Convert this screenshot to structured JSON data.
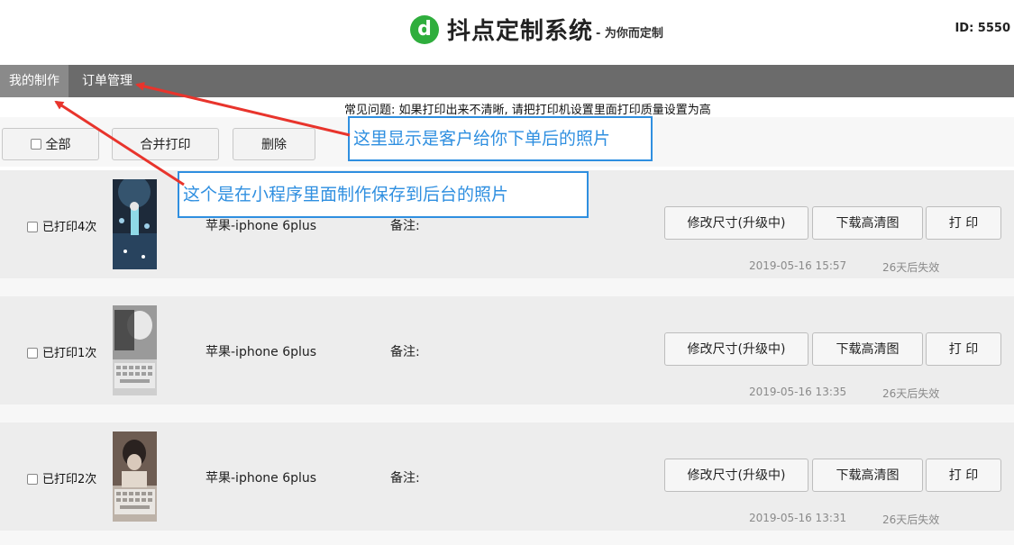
{
  "header": {
    "title": "抖点定制系统",
    "subtitle": "- 为你而定制",
    "user_id": "ID: 5550",
    "logo_letter": "d"
  },
  "nav": {
    "items": [
      "我的制作",
      "订单管理"
    ],
    "active": "我的制作"
  },
  "notice": "常见问题: 如果打印出来不清晰, 请把打印机设置里面打印质量设置为高",
  "toolbar": {
    "select_all": "全部",
    "merge_print": "合并打印",
    "delete": "删除"
  },
  "rows": [
    {
      "printed": "已打印4次",
      "model": "苹果-iphone 6plus",
      "note_label": "备注:",
      "btn_resize": "修改尺寸(升级中)",
      "btn_download": "下载高清图",
      "btn_print": "打 印",
      "time": "2019-05-16 15:57",
      "expire": "26天后失效"
    },
    {
      "printed": "已打印1次",
      "model": "苹果-iphone 6plus",
      "note_label": "备注:",
      "btn_resize": "修改尺寸(升级中)",
      "btn_download": "下载高清图",
      "btn_print": "打 印",
      "time": "2019-05-16 13:35",
      "expire": "26天后失效"
    },
    {
      "printed": "已打印2次",
      "model": "苹果-iphone 6plus",
      "note_label": "备注:",
      "btn_resize": "修改尺寸(升级中)",
      "btn_download": "下载高清图",
      "btn_print": "打 印",
      "time": "2019-05-16 13:31",
      "expire": "26天后失效"
    }
  ],
  "annotations": {
    "orders_note": "这里显示是客户给你下单后的照片",
    "works_note": "这个是在小程序里面制作保存到后台的照片",
    "color": "#2f8fe0",
    "arrow_color": "#e8342c"
  },
  "colors": {
    "brand": "#2fae3d",
    "navbar": "#6b6b6b",
    "nav_active": "#8a8a8a",
    "row_bg": "#ededed"
  }
}
